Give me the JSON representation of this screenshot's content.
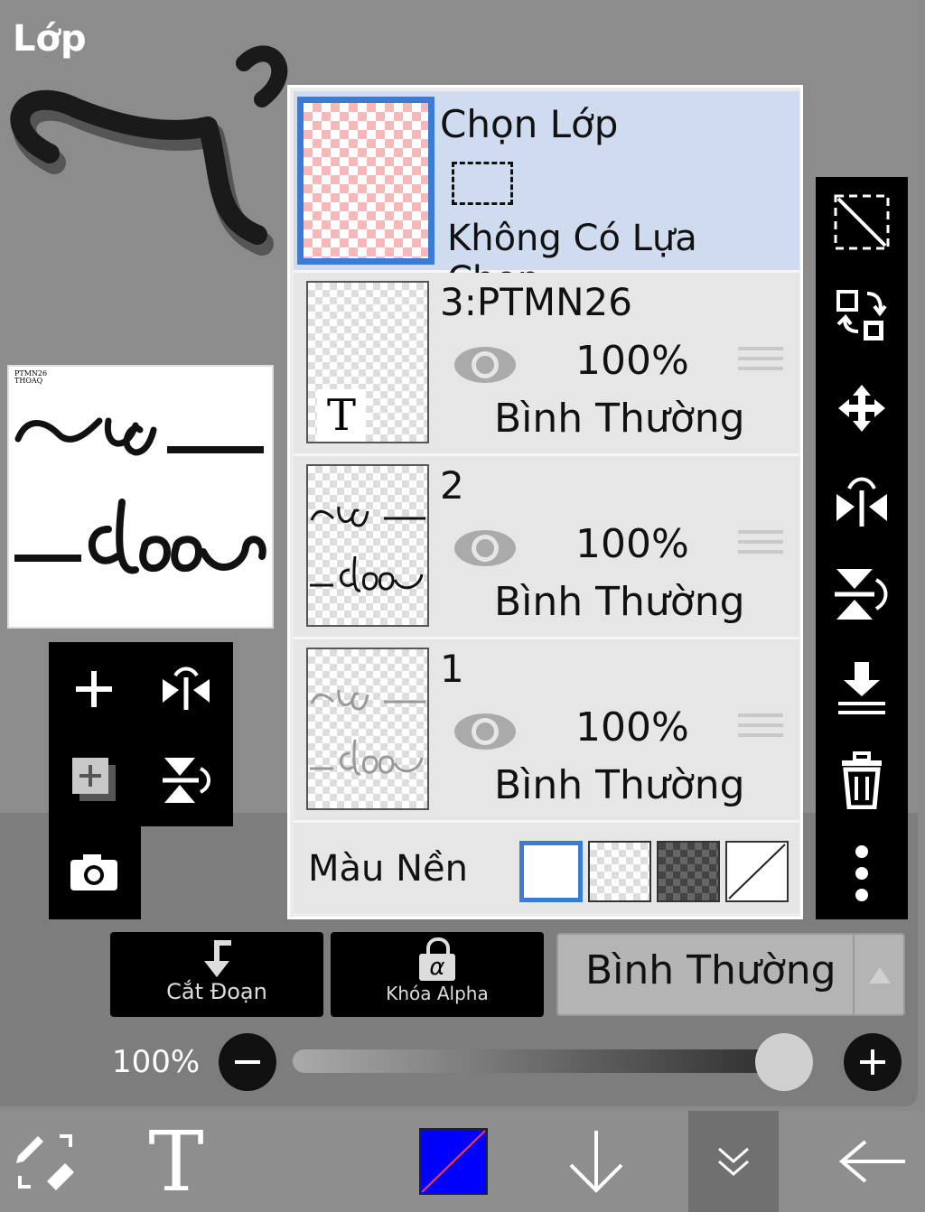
{
  "panel": {
    "title": "Lớp"
  },
  "preview": {
    "caption_line1": "PTMN26",
    "caption_line2": "THOAQ"
  },
  "layers": {
    "selection": {
      "title": "Chọn Lớp",
      "subtitle": "Không Có Lựa Chọn"
    },
    "items": [
      {
        "name": "3:PTMN26",
        "opacity": "100%",
        "blend": "Bình Thường",
        "thumb_icon": "T"
      },
      {
        "name": "2",
        "opacity": "100%",
        "blend": "Bình Thường"
      },
      {
        "name": "1",
        "opacity": "100%",
        "blend": "Bình Thường"
      }
    ],
    "background_label": "Màu Nền"
  },
  "actions": {
    "clip_label": "Cắt Đoạn",
    "alpha_lock_label": "Khóa Alpha",
    "alpha_symbol": "α",
    "blend_mode": "Bình Thường"
  },
  "opacity_slider": {
    "label": "100%",
    "value": 1.0
  },
  "colors": {
    "accent": "#3a7bd5",
    "current_color": "#0000ff",
    "selected_row": "#cfdcf0"
  },
  "bottom_bar": {
    "text_tool_glyph": "T"
  }
}
